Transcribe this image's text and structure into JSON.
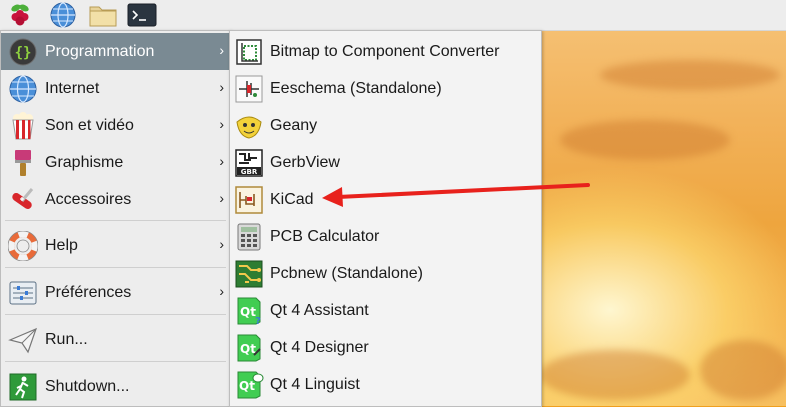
{
  "panel": {
    "launchers": [
      {
        "icon": "raspberry-menu-icon"
      },
      {
        "icon": "web-browser-icon"
      },
      {
        "icon": "file-manager-icon"
      },
      {
        "icon": "terminal-icon"
      }
    ]
  },
  "main_menu": {
    "items": [
      {
        "label": "Programmation",
        "icon": "braces-icon",
        "submenu": true
      },
      {
        "label": "Internet",
        "icon": "globe-icon",
        "submenu": true
      },
      {
        "label": "Son et vidéo",
        "icon": "popcorn-icon",
        "submenu": true
      },
      {
        "label": "Graphisme",
        "icon": "paintbrush-icon",
        "submenu": true
      },
      {
        "label": "Accessoires",
        "icon": "swiss-knife-icon",
        "submenu": true
      },
      {
        "label": "Help",
        "icon": "lifebuoy-icon",
        "submenu": true
      },
      {
        "label": "Préférences",
        "icon": "settings-panel-icon",
        "submenu": true
      },
      {
        "label": "Run...",
        "icon": "paper-plane-icon",
        "submenu": false
      },
      {
        "label": "Shutdown...",
        "icon": "exit-icon",
        "submenu": false
      }
    ],
    "active_index": 0,
    "arrow_glyph": "›"
  },
  "sub_menu": {
    "items": [
      {
        "label": "Bitmap to Component Converter",
        "icon": "bitmap-converter-icon"
      },
      {
        "label": "Eeschema (Standalone)",
        "icon": "eeschema-icon"
      },
      {
        "label": "Geany",
        "icon": "geany-icon"
      },
      {
        "label": "GerbView",
        "icon": "gerbview-icon"
      },
      {
        "label": "KiCad",
        "icon": "kicad-icon"
      },
      {
        "label": "PCB Calculator",
        "icon": "calculator-icon"
      },
      {
        "label": "Pcbnew (Standalone)",
        "icon": "pcbnew-icon"
      },
      {
        "label": "Qt 4 Assistant",
        "icon": "qt-assistant-icon"
      },
      {
        "label": "Qt 4 Designer",
        "icon": "qt-designer-icon"
      },
      {
        "label": "Qt 4 Linguist",
        "icon": "qt-linguist-icon"
      }
    ]
  },
  "annotation": {
    "color": "#e8211c",
    "points_to": "KiCad"
  },
  "colors": {
    "active_bg": "#7a8a93",
    "menu_bg": "#ededed"
  }
}
